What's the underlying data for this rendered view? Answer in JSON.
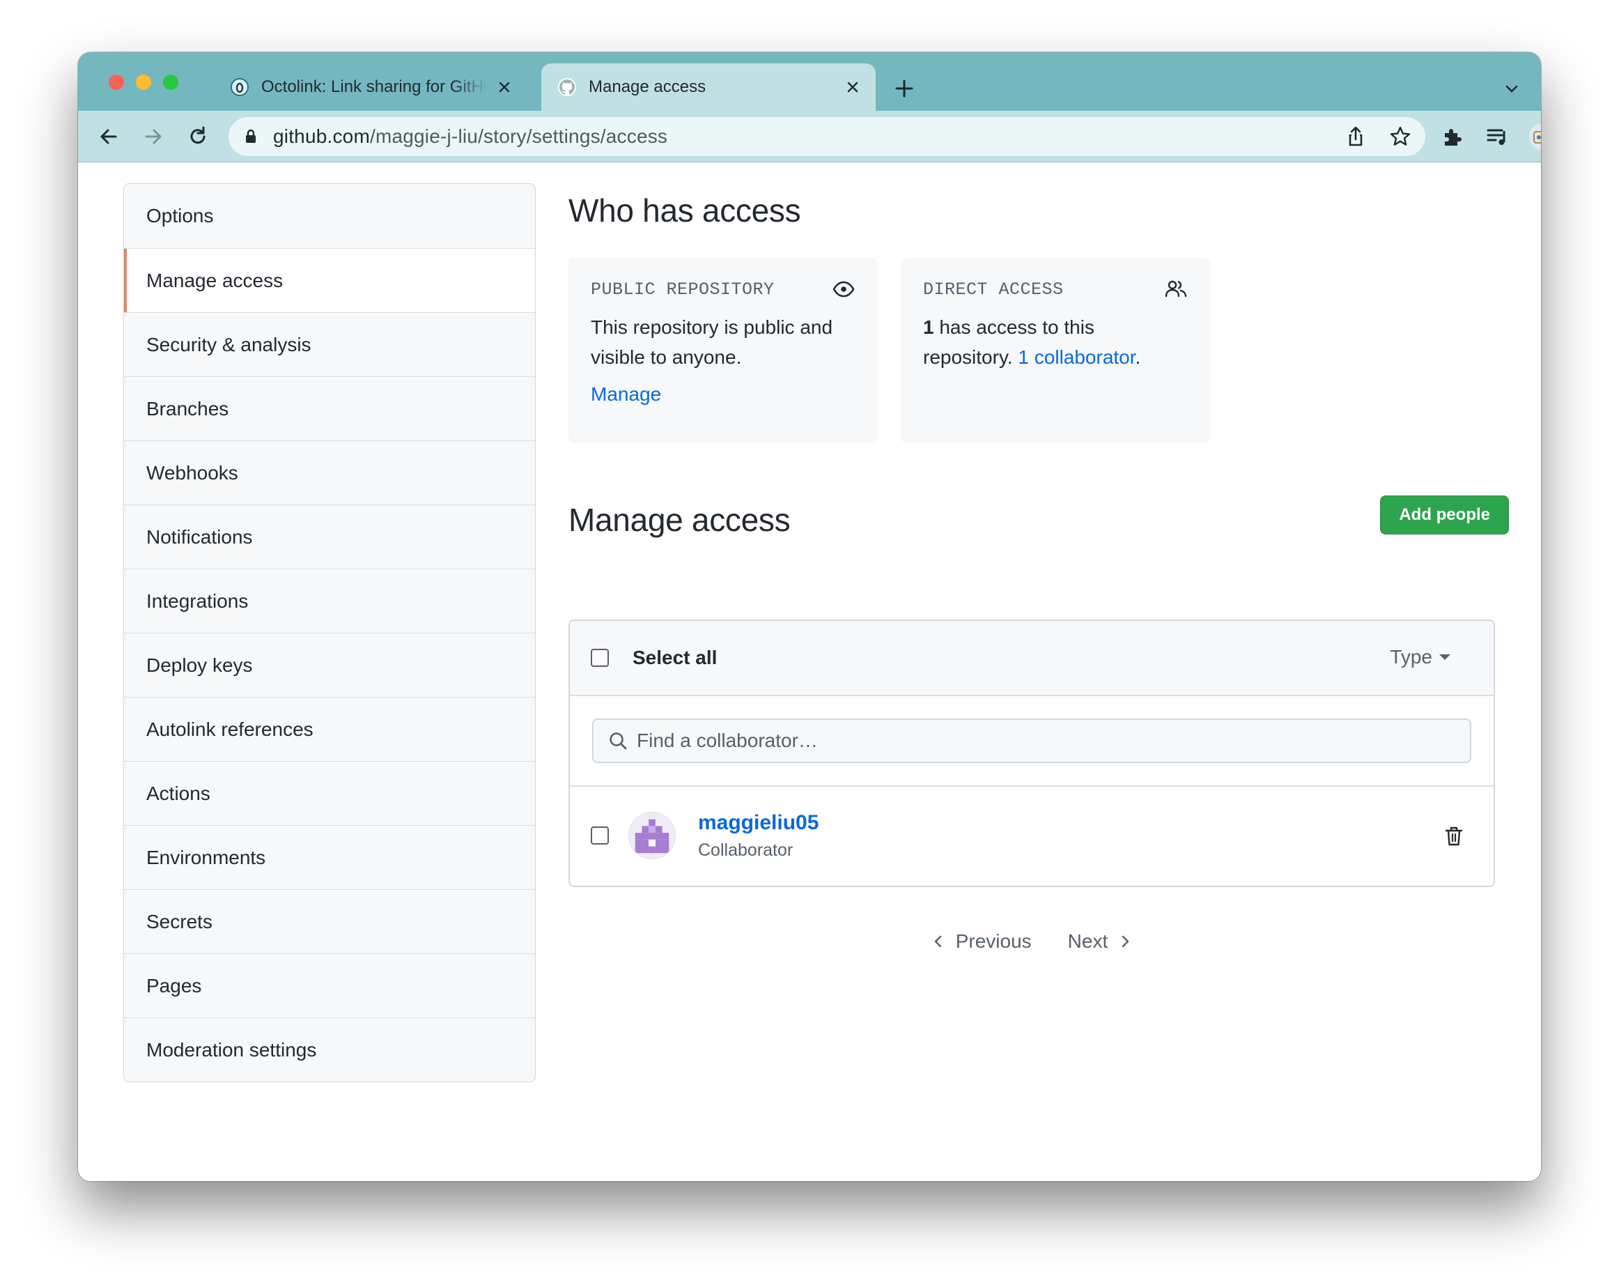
{
  "browser": {
    "tabs": [
      {
        "title": "Octolink: Link sharing for GitHub",
        "active": false
      },
      {
        "title": "Manage access",
        "active": true
      }
    ],
    "url_domain": "github.com",
    "url_path": "/maggie-j-liu/story/settings/access"
  },
  "sidebar": {
    "items": [
      {
        "label": "Options"
      },
      {
        "label": "Manage access",
        "selected": true
      },
      {
        "label": "Security & analysis"
      },
      {
        "label": "Branches"
      },
      {
        "label": "Webhooks"
      },
      {
        "label": "Notifications"
      },
      {
        "label": "Integrations"
      },
      {
        "label": "Deploy keys"
      },
      {
        "label": "Autolink references"
      },
      {
        "label": "Actions"
      },
      {
        "label": "Environments"
      },
      {
        "label": "Secrets"
      },
      {
        "label": "Pages"
      },
      {
        "label": "Moderation settings"
      }
    ]
  },
  "who_has_access": {
    "title": "Who has access",
    "public_card": {
      "label": "PUBLIC REPOSITORY",
      "icon": "eye-icon",
      "text": "This repository is public and visible to anyone.",
      "link": "Manage"
    },
    "direct_card": {
      "label": "DIRECT ACCESS",
      "icon": "people-icon",
      "count": "1",
      "text_mid": " has access to this repository. ",
      "link": "1 collaborator",
      "text_end": "."
    }
  },
  "manage_access": {
    "title": "Manage access",
    "add_button": "Add people",
    "select_all": "Select all",
    "type_filter": "Type",
    "search_placeholder": "Find a collaborator…",
    "members": [
      {
        "name": "maggieliu05",
        "role": "Collaborator"
      }
    ],
    "pagination": {
      "previous": "Previous",
      "next": "Next"
    }
  },
  "colors": {
    "accent_link": "#0969da",
    "primary_button": "#2da44e",
    "selected_indicator": "#e3866a",
    "browser_frame": "#75b7bf"
  }
}
